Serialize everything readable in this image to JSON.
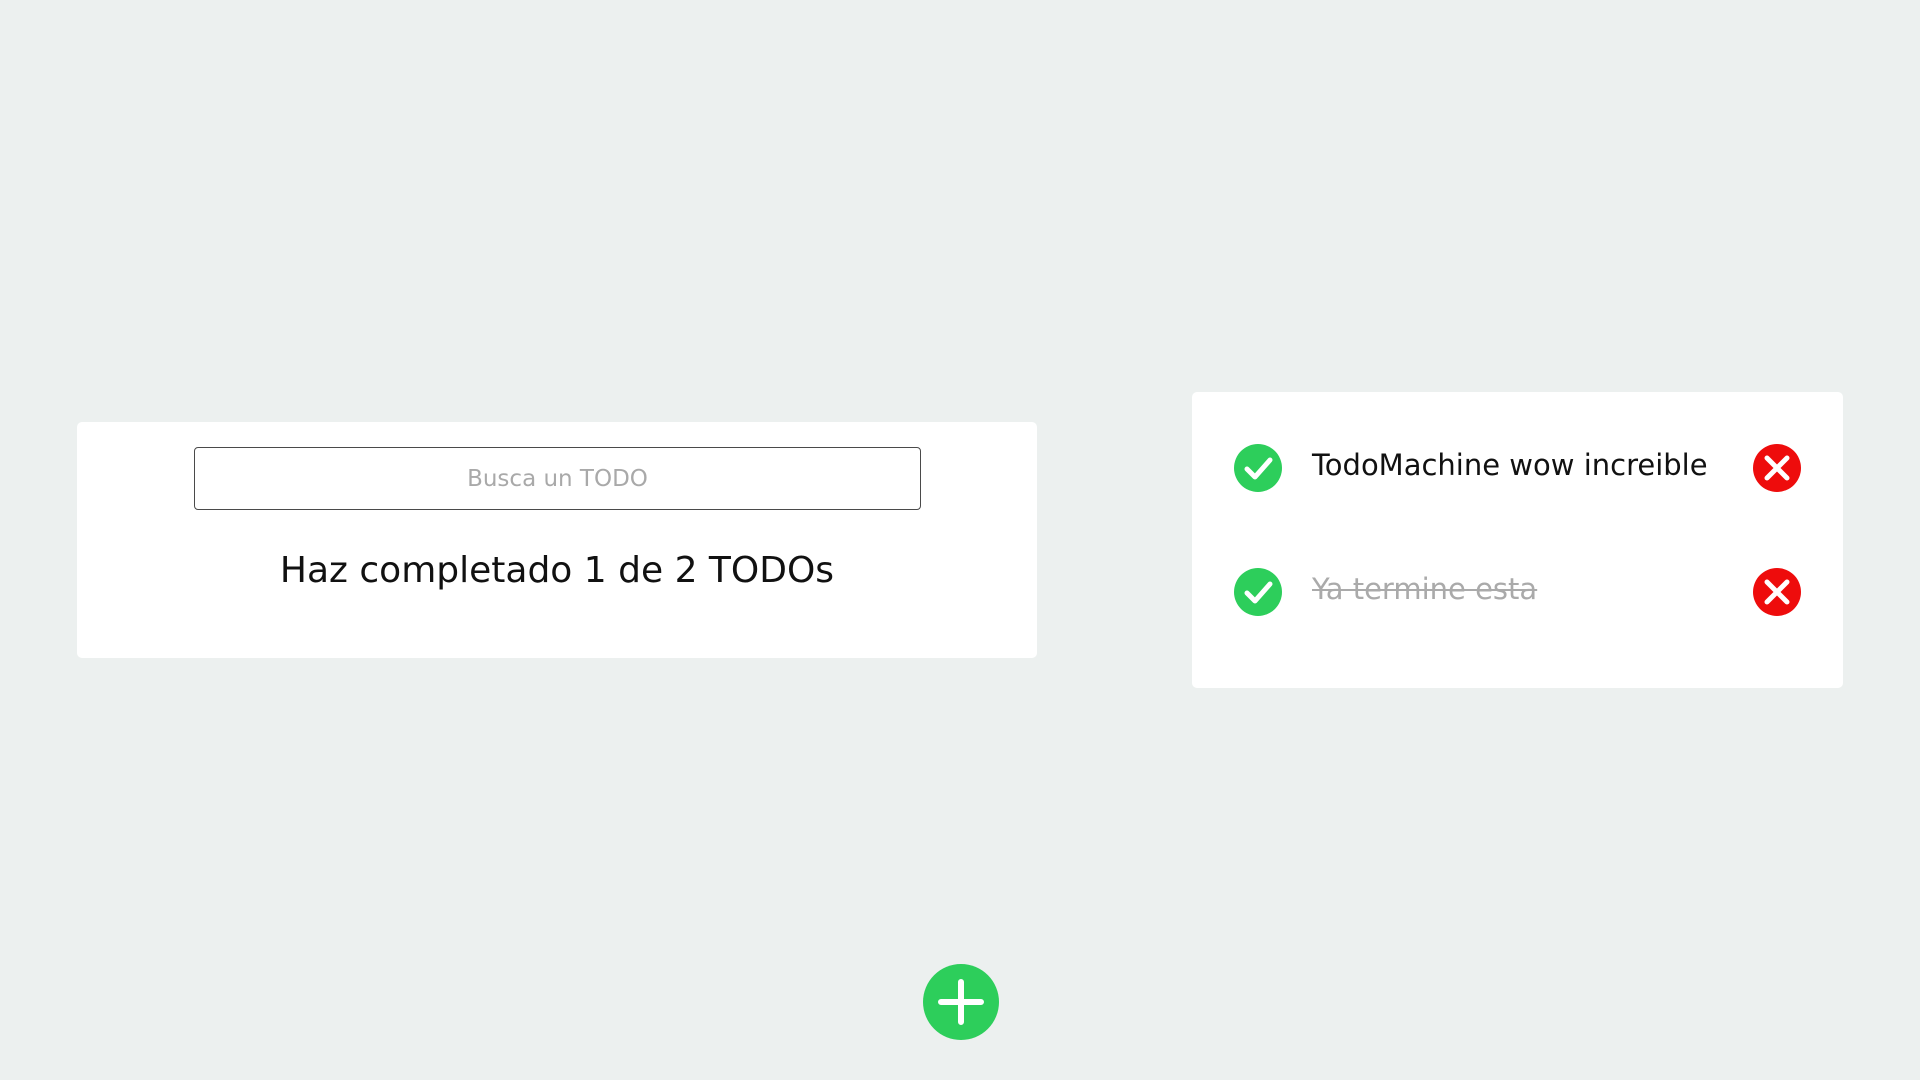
{
  "search": {
    "placeholder": "Busca un TODO",
    "value": ""
  },
  "counter": {
    "text": "Haz completado 1 de 2 TODOs"
  },
  "todos": [
    {
      "text": "TodoMachine wow increible",
      "completed": false
    },
    {
      "text": "Ya termine esta",
      "completed": true
    }
  ],
  "icons": {
    "check": "check-circle-icon",
    "delete": "delete-x-icon",
    "add": "plus-circle-icon"
  },
  "colors": {
    "background": "#ecf0ef",
    "check_green": "#2dce5b",
    "delete_red": "#ee0c0c",
    "add_green": "#2dce5b"
  }
}
